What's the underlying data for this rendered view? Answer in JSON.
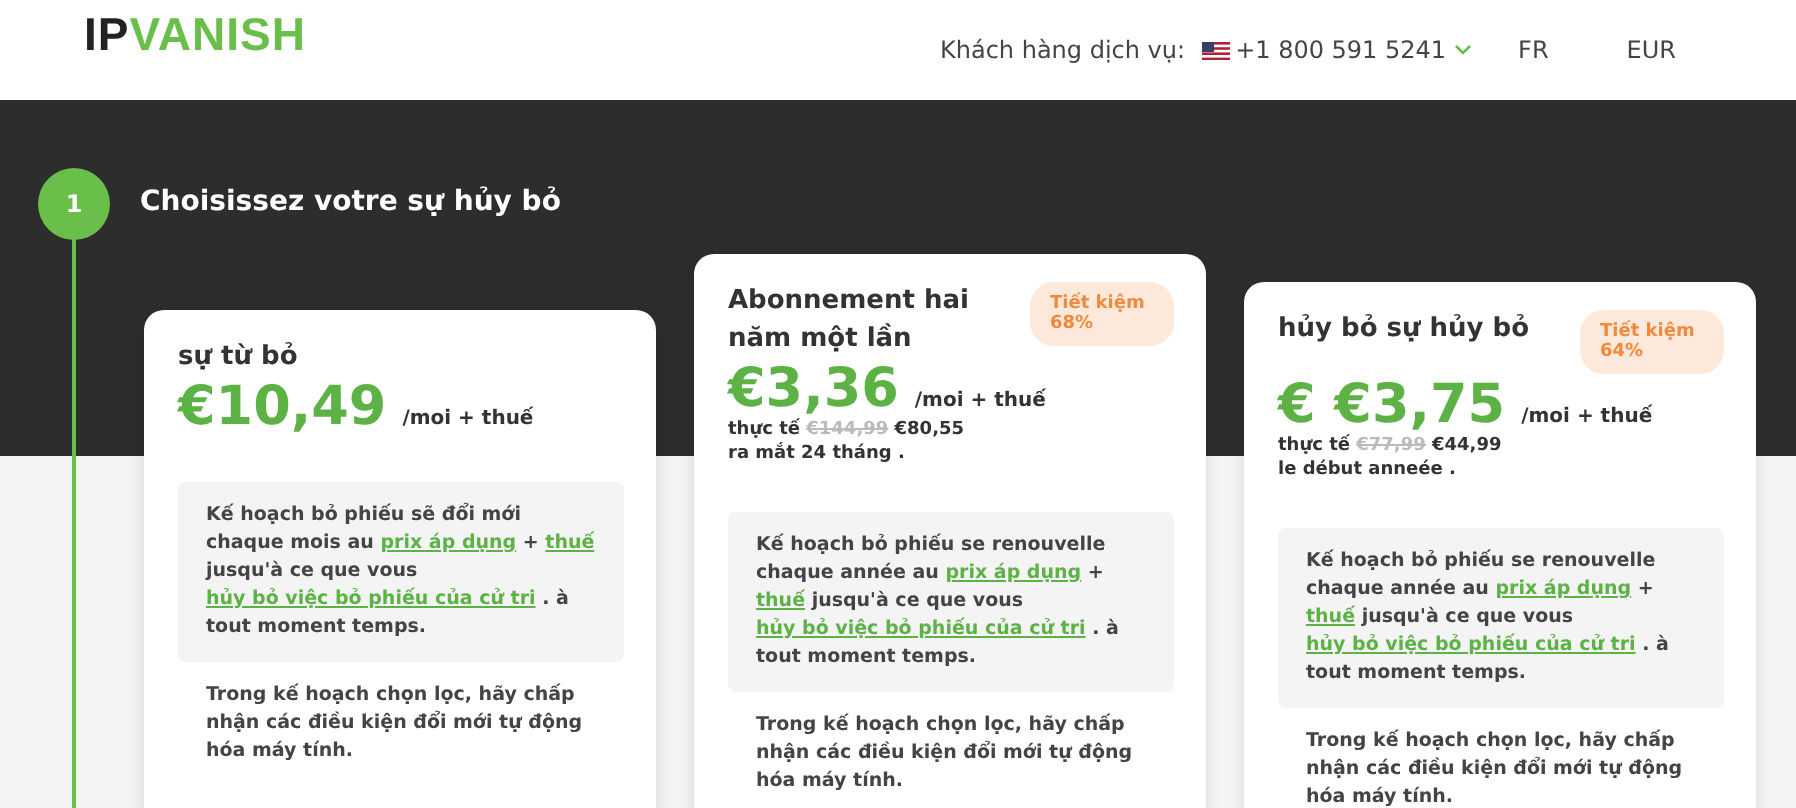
{
  "header": {
    "logo": [
      "IP",
      "VANISH"
    ],
    "support_label": "Khách hàng dịch vụ:",
    "phone": "+1 800 591 5241",
    "language": "FR",
    "currency": "EUR"
  },
  "step": {
    "number": "1",
    "title": "Choisissez votre sự hủy bỏ"
  },
  "plans": [
    {
      "name": "sự từ bỏ",
      "price": "€10,49",
      "per": "/moi + thuế",
      "renewal": [
        {
          "kind": "text",
          "text": "Kế hoạch bỏ phiếu sẽ đổi mới chaque mois au "
        },
        {
          "kind": "link",
          "text": "prix áp dụng"
        },
        {
          "kind": "text",
          "text": " + "
        },
        {
          "kind": "link",
          "text": "thuế"
        },
        {
          "kind": "text",
          "text": " jusqu'à ce que vous "
        },
        {
          "kind": "link",
          "text": "hủy bỏ việc bỏ phiếu của cử tri"
        },
        {
          "kind": "text",
          "text": " . à tout moment temps."
        }
      ],
      "note": "Trong kế hoạch chọn lọc, hãy chấp nhận các điều kiện đổi mới tự động hóa máy tính."
    },
    {
      "name": "Abonnement hai năm một lần",
      "badge": "Tiết kiệm 68%",
      "price": "€3,36",
      "per": "/moi + thuế",
      "regular": {
        "label": "thực tế",
        "old": "€144,99",
        "new": "€80,55"
      },
      "term": "ra mắt 24 tháng  .",
      "renewal": [
        {
          "kind": "text",
          "text": "Kế hoạch bỏ phiếu se renouvelle chaque année au "
        },
        {
          "kind": "link",
          "text": "prix áp dụng"
        },
        {
          "kind": "text",
          "text": " + "
        },
        {
          "kind": "link",
          "text": "thuế"
        },
        {
          "kind": "text",
          "text": " jusqu'à ce que vous "
        },
        {
          "kind": "link",
          "text": "hủy bỏ việc bỏ phiếu của cử tri"
        },
        {
          "kind": "text",
          "text": " . à tout moment temps."
        }
      ],
      "note": "Trong kế hoạch chọn lọc, hãy chấp nhận các điều kiện đổi mới tự động hóa máy tính."
    },
    {
      "name": "hủy bỏ sự hủy bỏ",
      "badge": "Tiết kiệm 64%",
      "price": "€ €3,75",
      "per": "/moi + thuế",
      "regular": {
        "label": "thực tế",
        "old": "€77,99",
        "new": "€44,99"
      },
      "term": "le début anneée  .",
      "renewal": [
        {
          "kind": "text",
          "text": "Kế hoạch bỏ phiếu se renouvelle chaque année au "
        },
        {
          "kind": "link",
          "text": "prix áp dụng"
        },
        {
          "kind": "text",
          "text": " + "
        },
        {
          "kind": "link",
          "text": "thuế"
        },
        {
          "kind": "text",
          "text": " jusqu'à ce que vous "
        },
        {
          "kind": "link",
          "text": "hủy bỏ việc bỏ phiếu của cử tri"
        },
        {
          "kind": "text",
          "text": " . à tout moment temps."
        }
      ],
      "note": "Trong kế hoạch chọn lọc, hãy chấp nhận các điều kiện đổi mới tự động hóa máy tính."
    }
  ]
}
